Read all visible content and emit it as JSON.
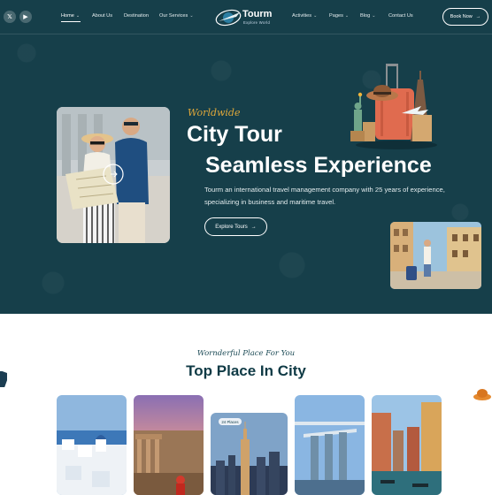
{
  "header": {
    "social": [
      {
        "name": "x-icon",
        "glyph": "𝕏"
      },
      {
        "name": "youtube-icon",
        "glyph": "▶"
      }
    ],
    "nav_left": [
      {
        "label": "Home",
        "has_dropdown": true,
        "active": true
      },
      {
        "label": "About Us",
        "has_dropdown": false
      },
      {
        "label": "Destination",
        "has_dropdown": false
      },
      {
        "label": "Our Services",
        "has_dropdown": true
      }
    ],
    "logo": {
      "name": "Tourm",
      "tagline": "Explore World"
    },
    "nav_right": [
      {
        "label": "Activities",
        "has_dropdown": true
      },
      {
        "label": "Pages",
        "has_dropdown": true
      },
      {
        "label": "Blog",
        "has_dropdown": true
      },
      {
        "label": "Contact Us",
        "has_dropdown": false
      }
    ],
    "cta_label": "Book Now",
    "chevron": "⌄",
    "arrow": "→"
  },
  "hero": {
    "script": "Worldwide",
    "title_line1": "City Tour",
    "title_line2": "Seamless Experience",
    "description": "Tourm an international travel management company with 25 years of experience, specializing in business and maritime travel.",
    "button_label": "Explore Tours",
    "colors": {
      "background": "#163f4a",
      "accent": "#e0a83a"
    }
  },
  "places": {
    "script": "Wornderful Place For You",
    "title": "Top Place In City",
    "badge": "24 Places"
  }
}
